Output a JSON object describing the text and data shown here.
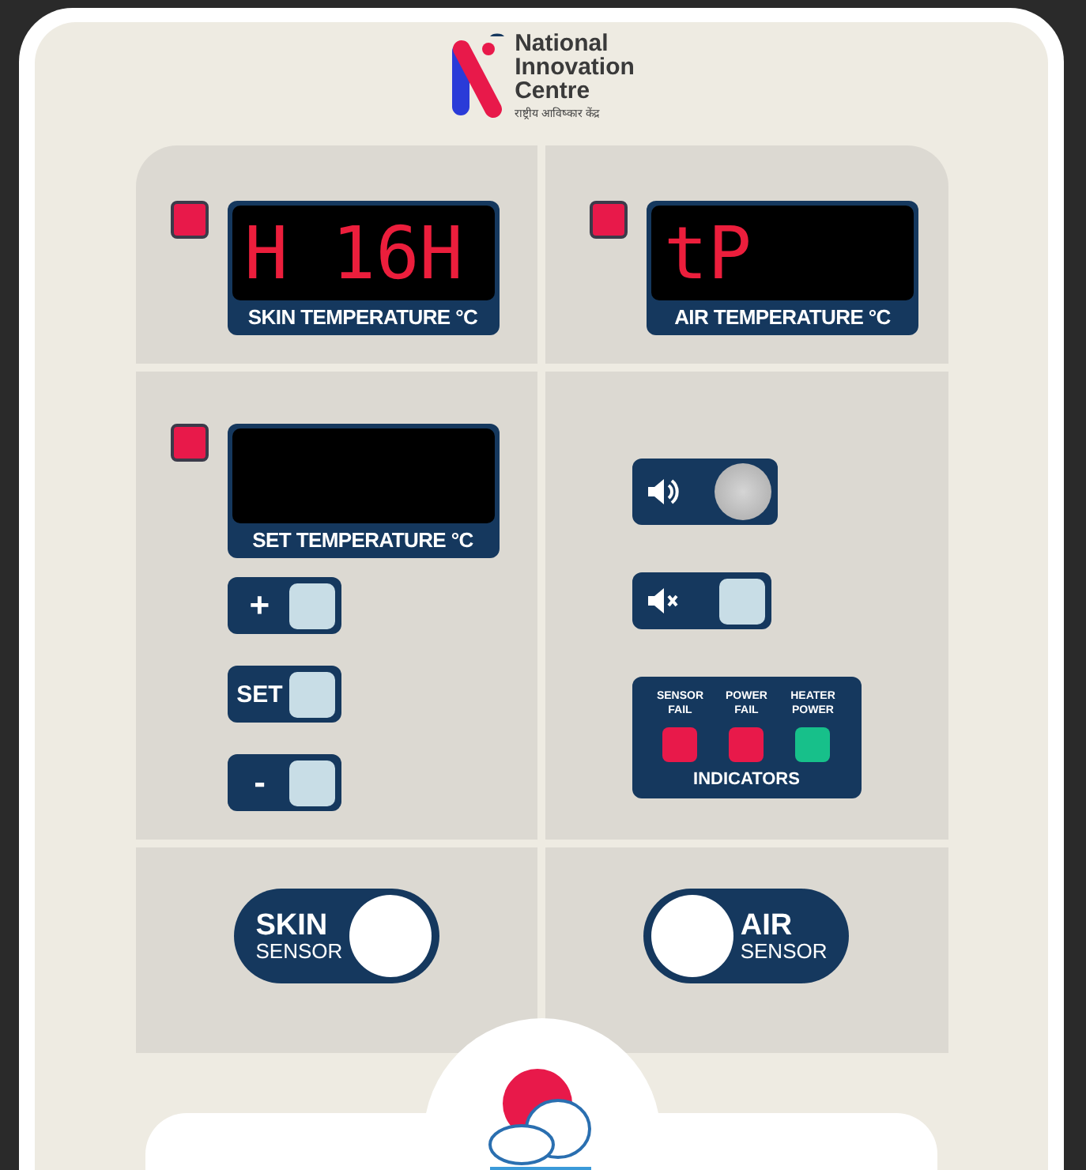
{
  "brand": {
    "name_lines": [
      "National",
      "Innovation",
      "Centre"
    ],
    "tagline": "राष्ट्रीय आविष्कार केंद्र"
  },
  "displays": [
    {
      "label": "SKIN TEMPERATURE °C",
      "value": "H 16H",
      "color": "#e8194a"
    },
    {
      "label": "AIR TEMPERATURE °C",
      "value": "tP",
      "color": "#e8194a"
    },
    {
      "label": "SET TEMPERATURE °C",
      "color": "#e8194a"
    }
  ],
  "set_buttons": [
    {
      "kind": "symbol",
      "label": "+"
    },
    {
      "kind": "text",
      "label": "SET"
    },
    {
      "kind": "symbol",
      "label": "-"
    }
  ],
  "alarm_buttons": [
    {
      "kind": "sound",
      "pressed": true
    },
    {
      "kind": "mute",
      "pressed": false
    }
  ],
  "indicators": {
    "title": "INDICATORS",
    "items": [
      {
        "label": "SENSOR FAIL",
        "color": "#e8194a"
      },
      {
        "label": "POWER FAIL",
        "color": "#e8194a"
      },
      {
        "label": "HEATER POWER",
        "color": "#17c08a"
      }
    ]
  },
  "sensors": [
    {
      "title": "SKIN",
      "subtitle": "SENSOR",
      "knob_on_right": true
    },
    {
      "title": "AIR",
      "subtitle": "SENSOR",
      "knob_on_right": false
    }
  ]
}
